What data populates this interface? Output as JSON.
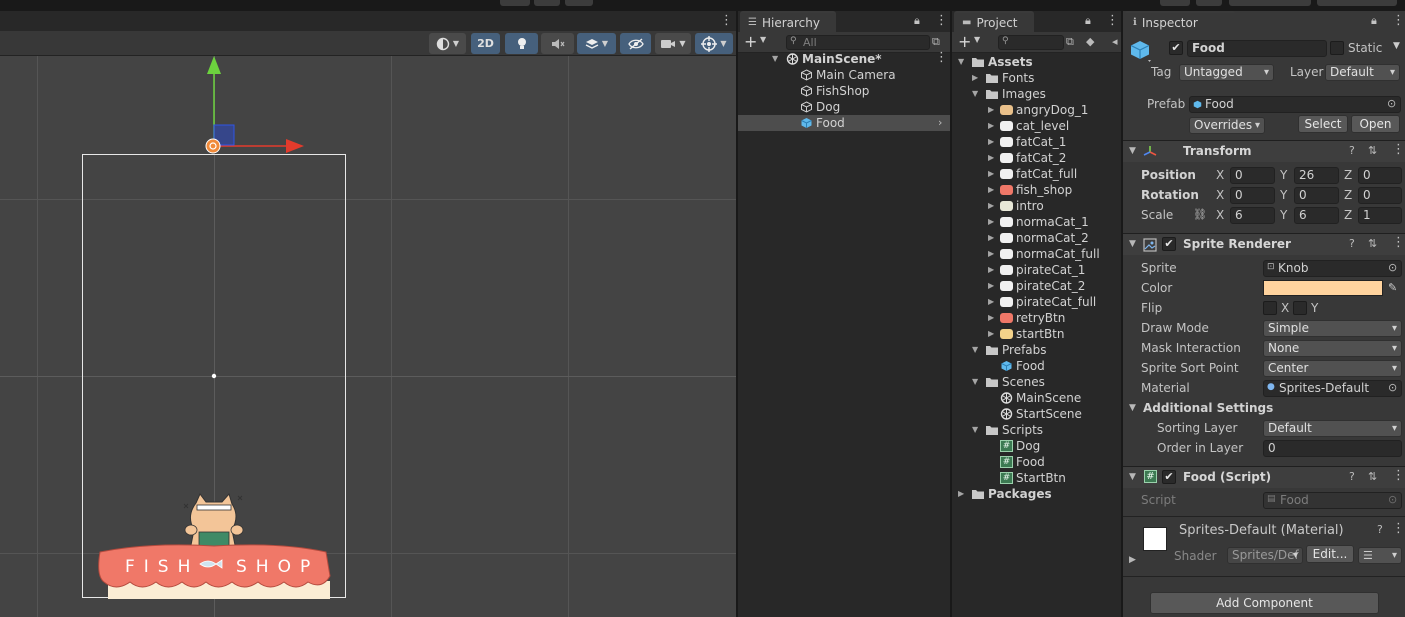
{
  "scene": {
    "toolbar": {
      "mode_2d": "2D"
    },
    "shop_sign": {
      "left": "FISH",
      "right": "SHOP"
    }
  },
  "hierarchy": {
    "tab": "Hierarchy",
    "search_placeholder": "All",
    "scene_name": "MainScene*",
    "items": [
      {
        "label": "Main Camera"
      },
      {
        "label": "FishShop"
      },
      {
        "label": "Dog"
      },
      {
        "label": "Food"
      }
    ]
  },
  "project": {
    "tab": "Project",
    "tree": {
      "assets": "Assets",
      "fonts": "Fonts",
      "images": "Images",
      "image_items": [
        "angryDog_1",
        "cat_level",
        "fatCat_1",
        "fatCat_2",
        "fatCat_full",
        "fish_shop",
        "intro",
        "normaCat_1",
        "normaCat_2",
        "normaCat_full",
        "pirateCat_1",
        "pirateCat_2",
        "pirateCat_full",
        "retryBtn",
        "startBtn"
      ],
      "prefabs": "Prefabs",
      "prefab_items": [
        "Food"
      ],
      "scenes": "Scenes",
      "scene_items": [
        "MainScene",
        "StartScene"
      ],
      "scripts": "Scripts",
      "script_items": [
        "Dog",
        "Food",
        "StartBtn"
      ],
      "packages": "Packages"
    }
  },
  "inspector": {
    "tab": "Inspector",
    "object_name": "Food",
    "static_label": "Static",
    "tag_label": "Tag",
    "tag_value": "Untagged",
    "layer_label": "Layer",
    "layer_value": "Default",
    "prefab_label": "Prefab",
    "prefab_value": "Food",
    "overrides": "Overrides",
    "select": "Select",
    "open": "Open",
    "transform": {
      "title": "Transform",
      "position_label": "Position",
      "rotation_label": "Rotation",
      "scale_label": "Scale",
      "x": "X",
      "y": "Y",
      "z": "Z",
      "position": [
        "0",
        "26",
        "0"
      ],
      "rotation": [
        "0",
        "0",
        "0"
      ],
      "scale": [
        "6",
        "6",
        "1"
      ]
    },
    "sprite_renderer": {
      "title": "Sprite Renderer",
      "sprite_label": "Sprite",
      "sprite_value": "Knob",
      "color_label": "Color",
      "color_value": "#ffd39e",
      "flip_label": "Flip",
      "flip_x": "X",
      "flip_y": "Y",
      "draw_mode_label": "Draw Mode",
      "draw_mode_value": "Simple",
      "mask_label": "Mask Interaction",
      "mask_value": "None",
      "sort_point_label": "Sprite Sort Point",
      "sort_point_value": "Center",
      "material_label": "Material",
      "material_value": "Sprites-Default",
      "additional_label": "Additional Settings",
      "sorting_layer_label": "Sorting Layer",
      "sorting_layer_value": "Default",
      "order_label": "Order in Layer",
      "order_value": "0"
    },
    "food_script": {
      "title": "Food (Script)",
      "script_label": "Script",
      "script_value": "Food"
    },
    "material": {
      "title": "Sprites-Default (Material)",
      "shader_label": "Shader",
      "shader_value": "Sprites/Def",
      "edit": "Edit..."
    },
    "add_component": "Add Component"
  }
}
